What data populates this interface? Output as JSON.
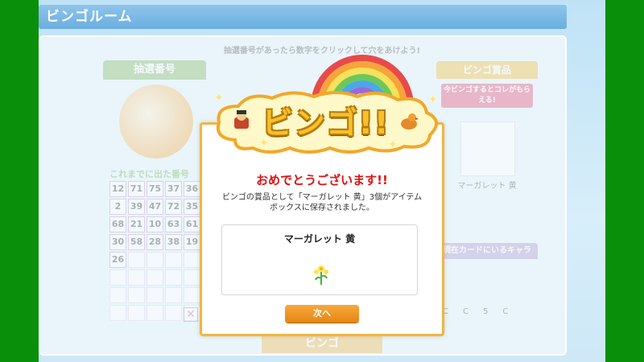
{
  "window": {
    "title": "ビンゴルーム"
  },
  "background": {
    "instruction": "抽選番号があったら数字をクリックして穴をあけよう!",
    "drawn_header": "抽選番号",
    "called_label": "これまでに出た番号",
    "called_numbers": [
      12,
      71,
      75,
      37,
      36,
      2,
      39,
      47,
      72,
      35,
      68,
      21,
      10,
      63,
      61,
      30,
      58,
      28,
      38,
      19,
      26
    ],
    "prize_header": "ビンゴ賞品",
    "prize_ribbon": "今ビンゴするとコレがもらえる!",
    "prize_name": "マーガレット 黄",
    "chars_header": "現在カードにいるキャラ",
    "chars_counts": [
      "C",
      "C",
      "5",
      "C"
    ],
    "bottom_tab": "ビンゴ"
  },
  "modal": {
    "banner": "ビンゴ!!",
    "congrats": "おめでとうございます!!",
    "message": "ビンゴの賞品として「マーガレット 黄」3個がアイテムボックスに保存されました。",
    "item_name": "マーガレット 黄",
    "item_icon": "yellow-flower-icon",
    "next_label": "次へ"
  },
  "colors": {
    "accent": "#f5b53c",
    "congrats": "#e01010",
    "button": "#e58714",
    "frame": "#0a8f0a"
  }
}
